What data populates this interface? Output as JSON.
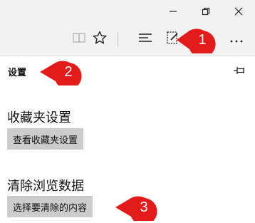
{
  "panel": {
    "title": "设置",
    "sections": [
      {
        "heading": "收藏夹设置",
        "button_label": "查看收藏夹设置"
      },
      {
        "heading": "清除浏览数据",
        "button_label": "选择要清除的内容"
      }
    ]
  },
  "callouts": [
    "1",
    "2",
    "3"
  ],
  "icons": {
    "window": [
      "minimize-icon",
      "restore-icon",
      "close-icon"
    ],
    "toolbar": [
      "reading-view-icon",
      "favorites-star-icon",
      "hub-icon",
      "web-note-icon",
      "more-actions-icon"
    ],
    "panel": [
      "pin-icon"
    ]
  },
  "colors": {
    "callout_red": "#e31b1b",
    "chrome": "#f2f2f2",
    "button_gray": "#cccccc"
  }
}
